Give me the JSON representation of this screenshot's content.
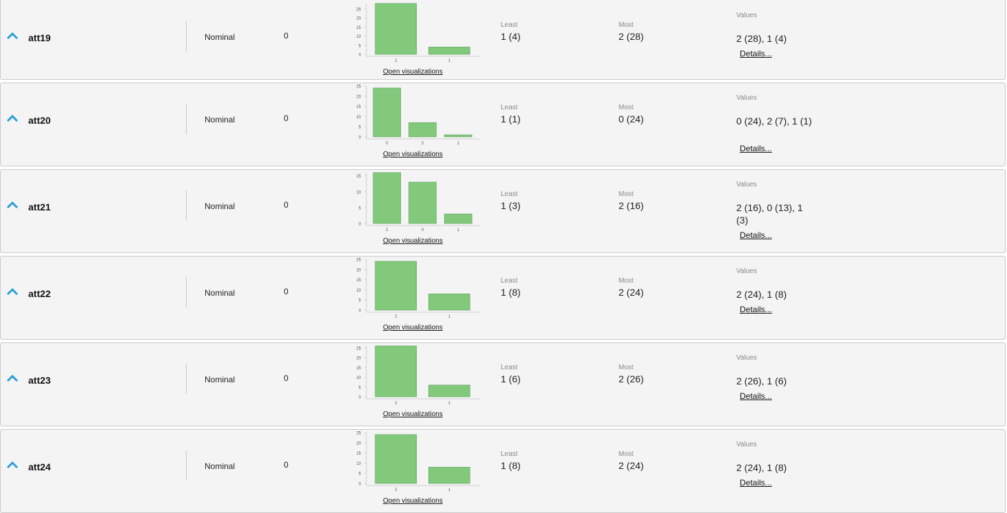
{
  "labels": {
    "least": "Least",
    "most": "Most",
    "values": "Values",
    "open_visualizations": "Open visualizations",
    "details": "Details..."
  },
  "colors": {
    "bar_fill": "#82c97c",
    "bar_stroke": "#5e9e5a",
    "toggle_icon": "#2a9fd6"
  },
  "icons": {
    "toggle": "chevron-up-icon"
  },
  "attributes": [
    {
      "name": "att19",
      "type": "Nominal",
      "missing": "0",
      "least": "1 (4)",
      "most": "2 (28)",
      "values": "2 (28), 1 (4)",
      "chart_data": {
        "type": "bar",
        "categories": [
          "2",
          "1"
        ],
        "values": [
          28,
          4
        ],
        "yticks": [
          "0",
          "5",
          "10",
          "15",
          "20",
          "25"
        ],
        "ylim": [
          0,
          28
        ]
      }
    },
    {
      "name": "att20",
      "type": "Nominal",
      "missing": "0",
      "least": "1 (1)",
      "most": "0 (24)",
      "values": "0 (24), 2 (7), 1 (1)",
      "chart_data": {
        "type": "bar",
        "categories": [
          "0",
          "2",
          "1"
        ],
        "values": [
          24,
          7,
          1
        ],
        "yticks": [
          "0",
          "5",
          "10",
          "15",
          "20",
          "25"
        ],
        "ylim": [
          0,
          25
        ]
      }
    },
    {
      "name": "att21",
      "type": "Nominal",
      "missing": "0",
      "least": "1 (3)",
      "most": "2 (16)",
      "values": "2 (16), 0 (13), 1 (3)",
      "chart_data": {
        "type": "bar",
        "categories": [
          "2",
          "0",
          "1"
        ],
        "values": [
          16,
          13,
          3
        ],
        "yticks": [
          "0",
          "5",
          "10",
          "15"
        ],
        "ylim": [
          0,
          16
        ]
      }
    },
    {
      "name": "att22",
      "type": "Nominal",
      "missing": "0",
      "least": "1 (8)",
      "most": "2 (24)",
      "values": "2 (24), 1 (8)",
      "chart_data": {
        "type": "bar",
        "categories": [
          "2",
          "1"
        ],
        "values": [
          24,
          8
        ],
        "yticks": [
          "0",
          "5",
          "10",
          "15",
          "20",
          "25"
        ],
        "ylim": [
          0,
          25
        ]
      }
    },
    {
      "name": "att23",
      "type": "Nominal",
      "missing": "0",
      "least": "1 (6)",
      "most": "2 (26)",
      "values": "2 (26), 1 (6)",
      "chart_data": {
        "type": "bar",
        "categories": [
          "2",
          "1"
        ],
        "values": [
          26,
          6
        ],
        "yticks": [
          "0",
          "5",
          "10",
          "15",
          "20",
          "25"
        ],
        "ylim": [
          0,
          26
        ]
      }
    },
    {
      "name": "att24",
      "type": "Nominal",
      "missing": "0",
      "least": "1 (8)",
      "most": "2 (24)",
      "values": "2 (24), 1 (8)",
      "chart_data": {
        "type": "bar",
        "categories": [
          "2",
          "1"
        ],
        "values": [
          24,
          8
        ],
        "yticks": [
          "0",
          "5",
          "10",
          "15",
          "20",
          "25"
        ],
        "ylim": [
          0,
          25
        ]
      }
    }
  ]
}
